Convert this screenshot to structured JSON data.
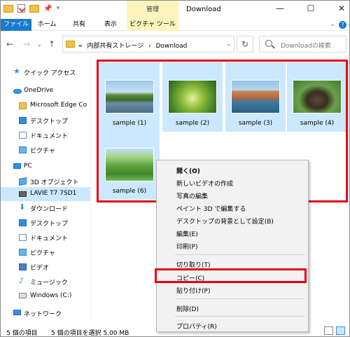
{
  "window": {
    "title": "Download",
    "context_tab_group": "管理"
  },
  "ribbon": {
    "tabs": [
      "ファイル",
      "ホーム",
      "共有",
      "表示",
      "ピクチャ ツール"
    ]
  },
  "address": {
    "prefix": "«",
    "path": [
      "内部共有ストレージ",
      "›",
      "Download"
    ],
    "search_placeholder": "Downloadの検索"
  },
  "sidebar": {
    "items": [
      {
        "label": "クイック アクセス",
        "icon": "star-icon"
      },
      {
        "label": "OneDrive",
        "icon": "cloud-icon"
      },
      {
        "label": "Microsoft Edge Co",
        "icon": "folder-icon"
      },
      {
        "label": "デスクトップ",
        "icon": "desktop-icon"
      },
      {
        "label": "ドキュメント",
        "icon": "documents-icon"
      },
      {
        "label": "ピクチャ",
        "icon": "pictures-icon"
      },
      {
        "label": "PC",
        "icon": "pc-icon"
      },
      {
        "label": "3D オブジェクト",
        "icon": "3d-objects-icon"
      },
      {
        "label": "LAVIE T7 7SD1",
        "icon": "device-icon"
      },
      {
        "label": "ダウンロード",
        "icon": "download-icon"
      },
      {
        "label": "デスクトップ",
        "icon": "desktop-icon"
      },
      {
        "label": "ドキュメント",
        "icon": "documents-icon"
      },
      {
        "label": "ピクチャ",
        "icon": "pictures-icon"
      },
      {
        "label": "ビデオ",
        "icon": "video-icon"
      },
      {
        "label": "ミュージック",
        "icon": "music-icon"
      },
      {
        "label": "Windows (C:)",
        "icon": "drive-icon"
      },
      {
        "label": "ネットワーク",
        "icon": "network-icon"
      }
    ]
  },
  "files": [
    {
      "name": "sample (1)",
      "selected": true
    },
    {
      "name": "sample (2)",
      "selected": true
    },
    {
      "name": "sample (3)",
      "selected": true
    },
    {
      "name": "sample (4)",
      "selected": true
    },
    {
      "name": "sample (6)",
      "selected": true
    }
  ],
  "context_menu": {
    "items": [
      "開く(O)",
      "新しいビデオの作成",
      "写真の編集",
      "ペイント 3D で編集する",
      "デスクトップの背景として設定(B)",
      "編集(E)",
      "印刷(P)",
      "切り取り(T)",
      "コピー(C)",
      "貼り付け(P)",
      "削除(D)",
      "プロパティ(R)"
    ],
    "highlighted": "コピー(C)"
  },
  "status": {
    "count": "5 個の項目",
    "selection": "5 個の項目を選択  5.00 MB"
  },
  "colors": {
    "accent": "#1979ca",
    "selection": "#cce8ff",
    "highlight_box": "#e60012",
    "context_tab": "#fbf4bd"
  }
}
